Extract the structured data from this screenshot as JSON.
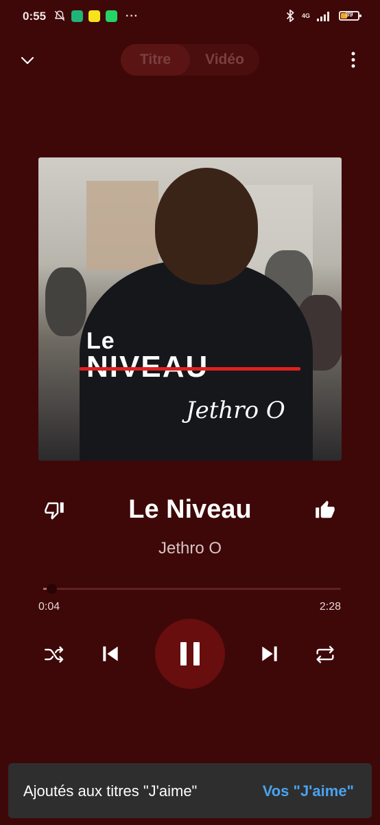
{
  "status_bar": {
    "time": "0:55",
    "network": "4G",
    "battery": "39",
    "dots": "···"
  },
  "header": {
    "tab_title": "Titre",
    "tab_video": "Vidéo"
  },
  "album_art": {
    "title_line1": "Le",
    "title_line2": "NIVEAU",
    "artist_line": "Jethro O"
  },
  "track": {
    "title": "Le Niveau",
    "artist": "Jethro O"
  },
  "playback": {
    "current_time": "0:04",
    "total_time": "2:28",
    "progress": 0.027
  },
  "snackbar": {
    "message": "Ajoutés aux titres \"J'aime\"",
    "action": "Vos \"J'aime\""
  },
  "colors": {
    "background": "#3e0808",
    "play_button": "#680e0e",
    "snackbar_bg": "#2e2e2e",
    "accent_link": "#4aa3ef"
  },
  "icons": {
    "collapse": "chevron-down-icon",
    "more": "more-vert-icon",
    "dislike": "thumb-down-icon",
    "like": "thumb-up-icon",
    "shuffle": "shuffle-icon",
    "previous": "skip-previous-icon",
    "pause": "pause-icon",
    "next": "skip-next-icon",
    "repeat": "repeat-icon"
  }
}
